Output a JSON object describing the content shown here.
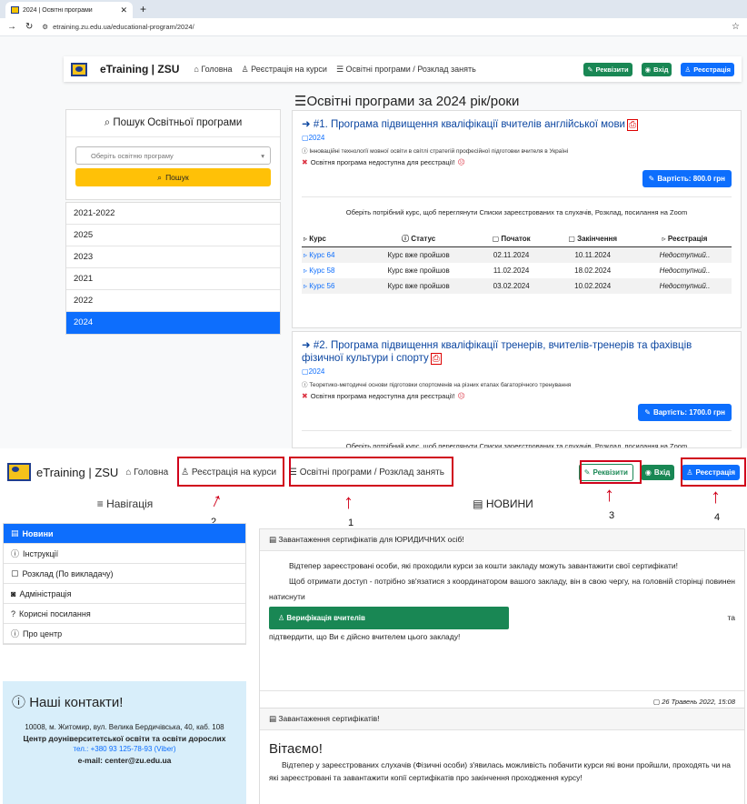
{
  "browser": {
    "tab_title": "2024 | Освітні програми",
    "url": "etraining.zu.edu.ua/educational-program/2024/"
  },
  "navbar": {
    "brand": "eTraining | ZSU",
    "home": "Головна",
    "register_courses": "Реєстрація на курси",
    "programs": "Освітні програми / Розклад занять",
    "rekvizyty": "Реквізити",
    "login": "Вхід",
    "registration": "Реєстрація"
  },
  "programs_page": {
    "heading": "Освітні програми за 2024 рік/роки",
    "search": {
      "title": "Пошук Освітньої програми",
      "select_placeholder": "Оберіть освітню програму",
      "button": "Пошук"
    },
    "years": [
      "2021-2022",
      "2025",
      "2023",
      "2021",
      "2022",
      "2024"
    ],
    "active_year": "2024",
    "program1": {
      "title": "#1. Програма підвищення кваліфікації вчителів англійської мови",
      "year": "2024",
      "desc": "Інноваційні технології мовної освіти в світлі стратегій професійної підготовки вчителя в Україні",
      "warning": "Освітня програма недоступна для реєстрації!",
      "price": "Вартість: 800.0 грн",
      "hint": "Оберіть потрібний курс, щоб переглянути Списки зареєстрованих та слухачів, Розклад, посилання на Zoom",
      "table_headers": [
        "Курс",
        "Статус",
        "Початок",
        "Закінчення",
        "Реєстрація"
      ],
      "rows": [
        [
          "Курс 64",
          "Курс вже пройшов",
          "02.11.2024",
          "10.11.2024",
          "Недоступний.."
        ],
        [
          "Курс 58",
          "Курс вже пройшов",
          "11.02.2024",
          "18.02.2024",
          "Недоступний.."
        ],
        [
          "Курс 56",
          "Курс вже пройшов",
          "03.02.2024",
          "10.02.2024",
          "Недоступний.."
        ]
      ]
    },
    "program2": {
      "title": "#2. Програма підвищення кваліфікації тренерів, вчителів-тренерів та фахівців фізичної культури і спорту",
      "year": "2024",
      "desc": "Теоретико-методичні основи підготовки спортсменів на різних етапах багаторічного тренування",
      "warning": "Освітня програма недоступна для реєстрації!",
      "price": "Вартість: 1700.0 грн",
      "hint": "Оберіть потрібний курс, щоб переглянути Списки зареєстрованих та слухачів, Розклад, посилання на Zoom"
    }
  },
  "annotations": {
    "labels": [
      "1",
      "2",
      "3",
      "4"
    ]
  },
  "home_page": {
    "nav_heading": "Навігація",
    "news_heading": "НОВИНИ",
    "nav_items": [
      "Новини",
      "Інструкції",
      "Розклад (По викладачу)",
      "Адміністрація",
      "Корисні посилання",
      "Про центр"
    ],
    "contacts": {
      "title": "Наші контакти!",
      "address": "10008, м. Житомир, вул. Велика Бердичівська, 40, каб. 108",
      "org": "Центр доуніверситетської освіти та освіти дорослих",
      "phone": "тел.: +380 93 125-78-93 (Viber)",
      "email": "e-mail: center@zu.edu.ua"
    },
    "news1": {
      "title": "Завантаження сертифікатів для ЮРИДИЧНИХ осіб!",
      "p1": "Відтепер зареєстровані особи, які проходили курси за кошти закладу можуть завантажити свої сертифікати!",
      "p2": "Щоб отримати доступ - потрібно зв'язатися з координатором вашого закладу, він в свою чергу, на головній сторінці повинен натиснути",
      "button": "Верифікація вчителів",
      "tail": "та",
      "p3": "підтвердити, що Ви є дійсно вчителем цього закладу!",
      "date": "26 Травень 2022, 15:08"
    },
    "news2": {
      "title": "Завантаження сертифікатів!",
      "greeting": "Вітаємо!",
      "text": "Відтепер у зареєстрованих слухачів (Фізичні особи) з'явилась можливість побачити курси які вони пройшли, проходять чи на які зареєстровані та завантажити копії сертифікатів про закінчення проходження курсу!"
    }
  }
}
